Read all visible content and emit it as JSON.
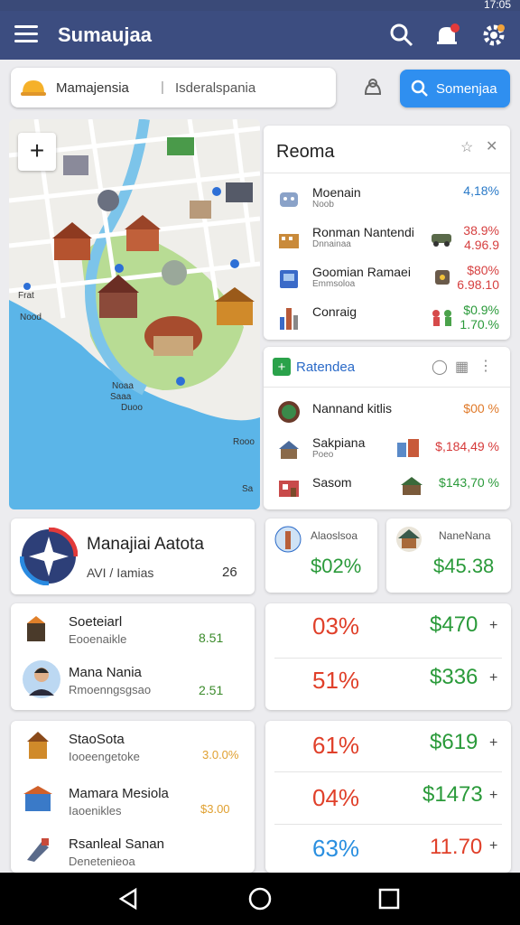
{
  "status": {
    "clock": "17:05"
  },
  "appbar": {
    "title": "Sumaujaa"
  },
  "search": {
    "brand_text": "Mamajensia",
    "separator": "|",
    "placeholder_text": "Isderalspania",
    "button_label": "Somenjaa"
  },
  "map": {
    "labels": {
      "fr": "Frat",
      "noo": "Nood",
      "noaa": "Noaa",
      "saaa": "Saaa",
      "duoo": "Duoo",
      "rooo": "Rooo",
      "sa": "Sa"
    }
  },
  "reoma": {
    "title": "Reoma",
    "rows": [
      {
        "name": "Moenain",
        "sub": "Noob",
        "value": "4,18%",
        "value2": "",
        "color": "#2a7ac8"
      },
      {
        "name": "Ronman Nantendi",
        "sub": "Dnnainaa",
        "value": "38.9%",
        "value2": "4.96.9",
        "color": "#d64040"
      },
      {
        "name": "Goomian Ramaei",
        "sub": "Emmsoloa",
        "value": "$80%",
        "value2": "6.98.10",
        "color": "#d64040"
      },
      {
        "name": "Conraig",
        "sub": "",
        "value": "$0.9%",
        "value2": "1.70.%",
        "color": "#2a9a3a"
      }
    ]
  },
  "ratendea": {
    "title": "Ratendea",
    "rows": [
      {
        "name": "Nannand kitlis",
        "value": "$00 %",
        "color": "#e07a2a"
      },
      {
        "name": "Sakpiana",
        "sub": "Poeo",
        "value": "$,184,49 %",
        "color": "#d63a3a"
      },
      {
        "name": "Sasom",
        "value": "$143,70 %",
        "color": "#2a9a3a"
      }
    ]
  },
  "account": {
    "title": "Manajiai Aatota",
    "sub": "AVI / Iamias",
    "value": "26"
  },
  "stat_a": {
    "label": "Alaoslsoa",
    "value": "$02%"
  },
  "stat_b": {
    "label": "NaneNana",
    "value": "$45.38"
  },
  "people": [
    {
      "name": "Soeteiarl",
      "sub": "Eooenaikle",
      "value": "8.51"
    },
    {
      "name": "Mana Nania",
      "sub": "Rmoenngsgsao",
      "value": "2.51"
    }
  ],
  "places": [
    {
      "name": "StaoSota",
      "sub": "Iooeengetoke",
      "value": "3.0.0%"
    },
    {
      "name": "Mamara Mesiola",
      "sub": "Iaoenikles",
      "value": "$3.00"
    },
    {
      "name": "Rsanleal Sanan",
      "sub": "Denetenieoa",
      "value": ""
    }
  ],
  "metrics": [
    {
      "pct": "03%",
      "amt": "$470",
      "pct_color": "#e0402a"
    },
    {
      "pct": "51%",
      "amt": "$336",
      "pct_color": "#e0402a"
    },
    {
      "pct": "61%",
      "amt": "$619",
      "pct_color": "#e0402a"
    },
    {
      "pct": "04%",
      "amt": "$1473",
      "pct_color": "#e0402a"
    },
    {
      "pct": "63%",
      "amt": "11.70",
      "pct_color": "#2a8fe0"
    }
  ],
  "metrics_plus": "+"
}
